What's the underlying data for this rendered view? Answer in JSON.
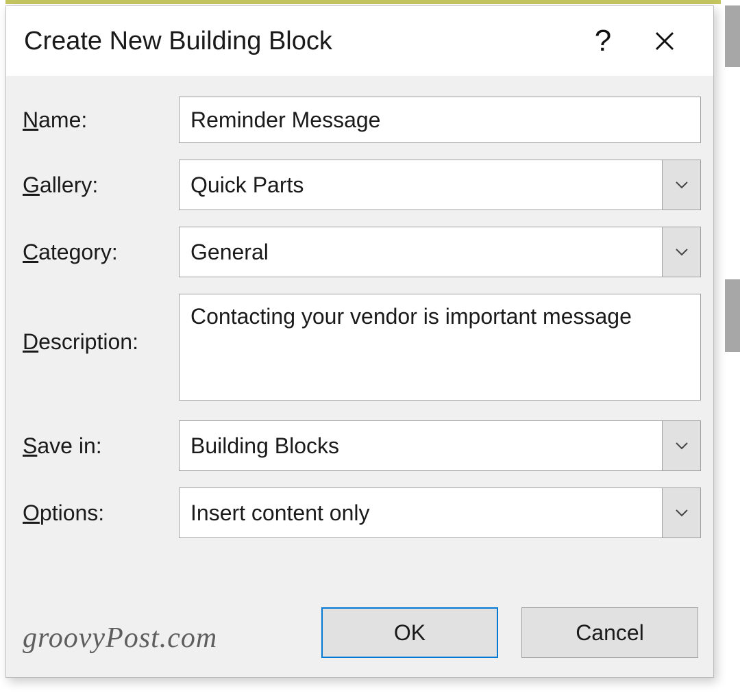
{
  "dialog": {
    "title": "Create New Building Block",
    "help_symbol": "?"
  },
  "form": {
    "name": {
      "label_pre": "N",
      "label_post": "ame:",
      "value": "Reminder Message"
    },
    "gallery": {
      "label_pre": "G",
      "label_post": "allery:",
      "value": "Quick Parts"
    },
    "category": {
      "label_pre": "C",
      "label_post": "ategory:",
      "value": "General"
    },
    "description": {
      "label_pre": "D",
      "label_post": "escription:",
      "value": "Contacting your vendor is important message"
    },
    "savein": {
      "label_pre": "S",
      "label_post": "ave in:",
      "value": "Building Blocks"
    },
    "options": {
      "label_pre": "O",
      "label_post": "ptions:",
      "value": "Insert content only"
    }
  },
  "buttons": {
    "ok": "OK",
    "cancel": "Cancel"
  },
  "watermark": "groovyPost.com"
}
